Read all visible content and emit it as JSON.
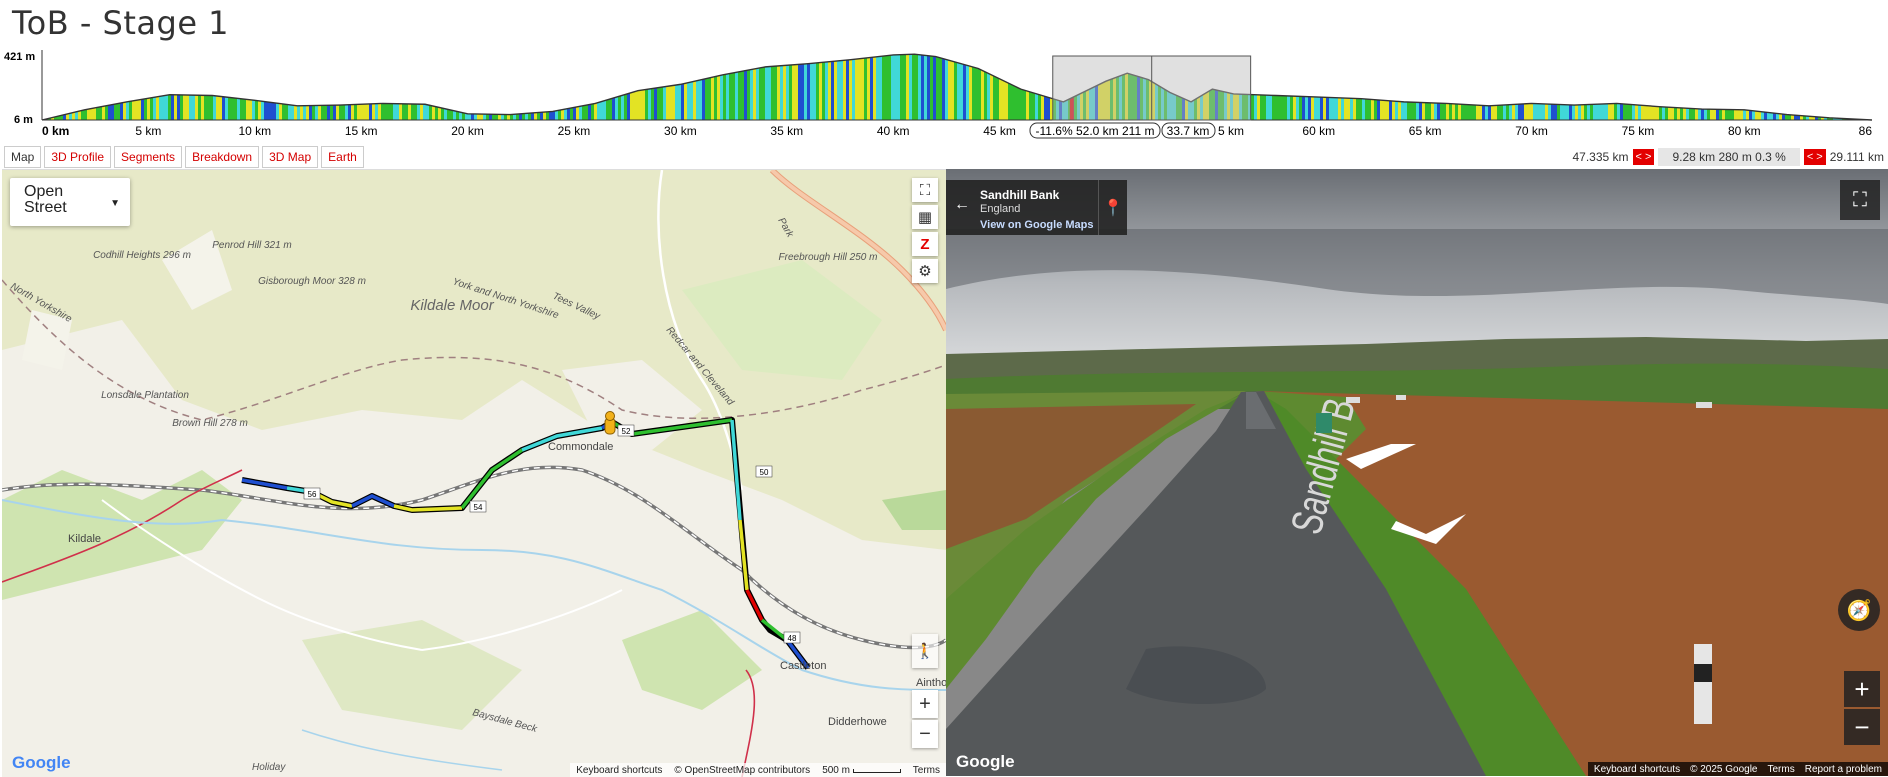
{
  "title": "ToB - Stage 1",
  "profile": {
    "ymax_label": "421 m",
    "ymin_label": "6 m",
    "x_ticks": [
      "0 km",
      "5 km",
      "10 km",
      "15 km",
      "20 km",
      "25 km",
      "30 km",
      "35 km",
      "40 km",
      "45 km",
      "",
      "",
      "60 km",
      "65 km",
      "70 km",
      "75 km",
      "80 km",
      "86"
    ],
    "x_ticks_partial": [
      "5 km"
    ],
    "selection_label": "-11.6% 52.0 km 211 m",
    "cursor_label": "33.7 km"
  },
  "chart_data": {
    "type": "area",
    "title": "",
    "xlabel": "",
    "ylabel": "",
    "xlim": [
      0,
      86
    ],
    "ylim": [
      6,
      421
    ],
    "x": [
      0,
      2,
      4,
      6,
      8,
      10,
      12,
      14,
      16,
      18,
      20,
      22,
      24,
      26,
      28,
      30,
      32,
      34,
      36,
      38,
      40,
      41,
      42,
      44,
      46,
      48,
      50,
      51,
      52,
      53,
      54,
      55,
      56,
      58,
      60,
      62,
      64,
      66,
      68,
      70,
      72,
      74,
      76,
      78,
      80,
      82,
      84,
      86
    ],
    "series": [
      {
        "values": [
          6,
          70,
          120,
          165,
          160,
          130,
          95,
          100,
          110,
          105,
          45,
          40,
          60,
          110,
          190,
          230,
          290,
          340,
          360,
          385,
          415,
          420,
          405,
          330,
          200,
          120,
          250,
          300,
          260,
          180,
          120,
          200,
          170,
          160,
          150,
          140,
          120,
          110,
          95,
          110,
          100,
          110,
          90,
          75,
          70,
          40,
          20,
          6
        ]
      }
    ],
    "selection_km": [
      47.5,
      56.8
    ]
  },
  "tabs": [
    {
      "label": "Map"
    },
    {
      "label": "3D Profile"
    },
    {
      "label": "Segments"
    },
    {
      "label": "Breakdown"
    },
    {
      "label": "3D Map"
    },
    {
      "label": "Earth"
    }
  ],
  "stats": {
    "left": "47.335 km",
    "arrows": "< >",
    "middle": "9.28 km 280 m 0.3 %",
    "right": "29.111 km"
  },
  "map": {
    "layer_select": "Open Street",
    "labels": {
      "codhill": "Codhill Heights 296 m",
      "penrod": "Penrod Hill 321 m",
      "gisborough": "Gisborough Moor 328 m",
      "kildale_moor": "Kildale Moor",
      "freebrough": "Freebrough Hill 250 m",
      "lonsdale": "Lonsdale Plantation",
      "brown_hill": "Brown Hill 278 m",
      "kildale": "Kildale",
      "commondale": "Commondale",
      "castleton": "Castleton",
      "ainthorpe": "Ainthorpe",
      "danby": "Didderhowe",
      "north_yorkshire": "North Yorkshire",
      "york_ny": "York and North Yorkshire",
      "tees_valley": "Tees Valley",
      "redcar": "Redcar and Cleveland",
      "baysdale": "Baysdale Beck",
      "holiday": "Holiday",
      "park": "Park"
    },
    "markers": [
      "56",
      "54",
      "52",
      "50",
      "48"
    ],
    "footer": {
      "shortcuts": "Keyboard shortcuts",
      "attribution": "© OpenStreetMap contributors",
      "scale": "500 m",
      "terms": "Terms"
    },
    "logo": "Google"
  },
  "streetview": {
    "place": "Sandhill Bank",
    "region": "England",
    "link": "View on Google Maps",
    "road_text": "Sandhill B",
    "footer": {
      "shortcuts": "Keyboard shortcuts",
      "copyright": "© 2025 Google",
      "terms": "Terms",
      "report": "Report a problem"
    },
    "logo": "Google"
  },
  "colors": {
    "tab_red": "#d40000",
    "route_outline": "#000000",
    "grad_green": "#2fbf2f",
    "grad_yellow": "#e3e324",
    "grad_cyan": "#40d8d8",
    "grad_blue": "#1f4fd0",
    "grad_red": "#e00000"
  }
}
